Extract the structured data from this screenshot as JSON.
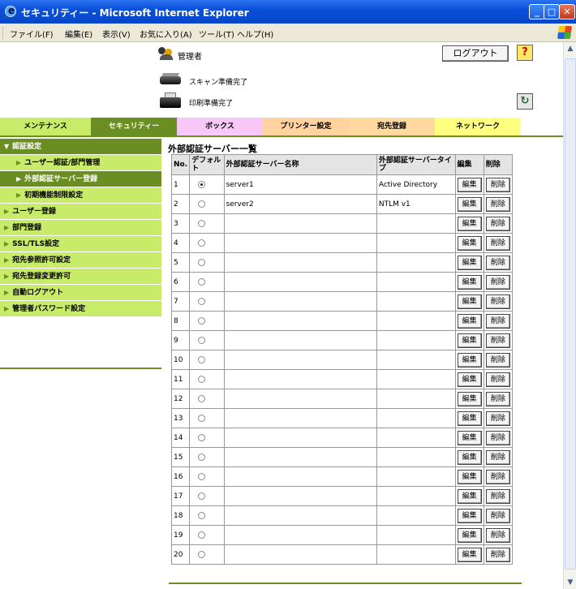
{
  "window": {
    "title": "セキュリティー - Microsoft Internet Explorer"
  },
  "menu": [
    "ファイル(F)",
    "編集(E)",
    "表示(V)",
    "お気に入り(A)",
    "ツール(T)",
    "ヘルプ(H)"
  ],
  "header": {
    "user": "管理者",
    "logout": "ログアウト",
    "help": "?",
    "scan_status": "スキャン準備完了",
    "print_status": "印刷準備完了"
  },
  "tabs": [
    {
      "label": "メンテナンス",
      "color": "#c8ec6a"
    },
    {
      "label": "セキュリティー",
      "color": "#6b8e23",
      "active": true
    },
    {
      "label": "ボックス",
      "color": "#f7c8f7"
    },
    {
      "label": "プリンター設定",
      "color": "#ffd2a0"
    },
    {
      "label": "宛先登録",
      "color": "#ffd9a0"
    },
    {
      "label": "ネットワーク",
      "color": "#ffff80"
    }
  ],
  "sidebar": {
    "items": [
      {
        "label": "認証設定",
        "type": "top",
        "icon": "triangle-down"
      },
      {
        "label": "ユーザー認証/部門管理",
        "type": "sub"
      },
      {
        "label": "外部認証サーバー登録",
        "type": "sub-active"
      },
      {
        "label": "初期機能制限設定",
        "type": "sub"
      },
      {
        "label": "ユーザー登録",
        "type": "item"
      },
      {
        "label": "部門登録",
        "type": "item"
      },
      {
        "label": "SSL/TLS設定",
        "type": "item"
      },
      {
        "label": "宛先参照許可設定",
        "type": "item"
      },
      {
        "label": "宛先登録変更許可",
        "type": "item"
      },
      {
        "label": "自動ログアウト",
        "type": "item"
      },
      {
        "label": "管理者パスワード設定",
        "type": "item"
      }
    ]
  },
  "main": {
    "title": "外部認証サーバー一覧",
    "columns": {
      "no": "No.",
      "default": "デフォルト",
      "name": "外部認証サーバー名称",
      "type": "外部認証サーバータイプ",
      "edit": "編集",
      "delete": "削除"
    },
    "edit_label": "編集",
    "delete_label": "削除",
    "rows": [
      {
        "no": "1",
        "name": "server1",
        "type": "Active Directory",
        "checked": true
      },
      {
        "no": "2",
        "name": "server2",
        "type": "NTLM v1"
      },
      {
        "no": "3",
        "name": "",
        "type": ""
      },
      {
        "no": "4",
        "name": "",
        "type": ""
      },
      {
        "no": "5",
        "name": "",
        "type": ""
      },
      {
        "no": "6",
        "name": "",
        "type": ""
      },
      {
        "no": "7",
        "name": "",
        "type": ""
      },
      {
        "no": "8",
        "name": "",
        "type": ""
      },
      {
        "no": "9",
        "name": "",
        "type": ""
      },
      {
        "no": "10",
        "name": "",
        "type": ""
      },
      {
        "no": "11",
        "name": "",
        "type": ""
      },
      {
        "no": "12",
        "name": "",
        "type": ""
      },
      {
        "no": "13",
        "name": "",
        "type": ""
      },
      {
        "no": "14",
        "name": "",
        "type": ""
      },
      {
        "no": "15",
        "name": "",
        "type": ""
      },
      {
        "no": "16",
        "name": "",
        "type": ""
      },
      {
        "no": "17",
        "name": "",
        "type": ""
      },
      {
        "no": "18",
        "name": "",
        "type": ""
      },
      {
        "no": "19",
        "name": "",
        "type": ""
      },
      {
        "no": "20",
        "name": "",
        "type": ""
      }
    ]
  }
}
